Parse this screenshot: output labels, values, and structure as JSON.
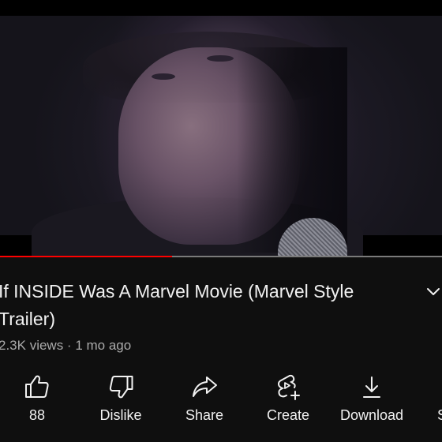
{
  "video": {
    "title": "If INSIDE Was A Marvel Movie (Marvel Style Trailer)",
    "progress": 0.39
  },
  "meta": {
    "views": "2.3K views",
    "separator": " · ",
    "age": "1 mo ago"
  },
  "actions": {
    "like_count": "88",
    "dislike_label": "Dislike",
    "share_label": "Share",
    "create_label": "Create",
    "download_label": "Download",
    "partial_label": "S"
  },
  "colors": {
    "progress": "#ff0000",
    "background": "#0f0f0f",
    "text": "#f1f1f1",
    "secondary_text": "#aaaaaa"
  }
}
